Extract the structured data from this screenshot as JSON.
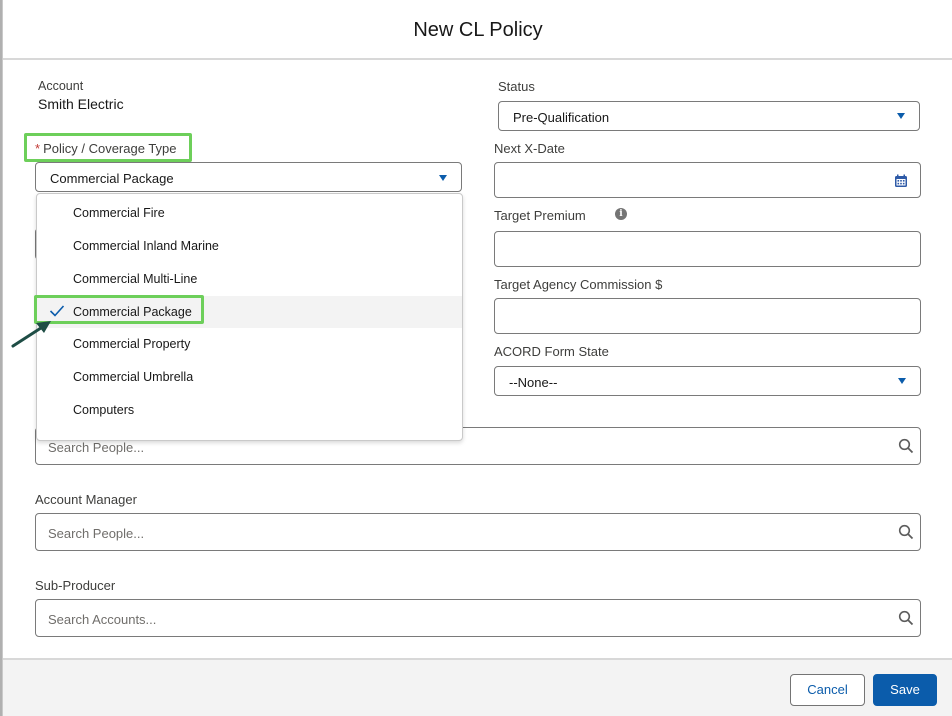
{
  "modal": {
    "title": "New CL Policy"
  },
  "account": {
    "label": "Account",
    "value": "Smith Electric"
  },
  "policy_type": {
    "label": "Policy / Coverage Type",
    "required_marker": "*",
    "value": "Commercial Package",
    "options": [
      "Commercial Fire",
      "Commercial Inland Marine",
      "Commercial Multi-Line",
      "Commercial Package",
      "Commercial Property",
      "Commercial Umbrella",
      "Computers"
    ],
    "selected_option": "Commercial Package"
  },
  "status": {
    "label": "Status",
    "value": "Pre-Qualification"
  },
  "next_x_date": {
    "label": "Next X-Date",
    "value": ""
  },
  "target_premium": {
    "label": "Target Premium",
    "info_icon": "i",
    "value": ""
  },
  "target_agency_commission": {
    "label": "Target Agency Commission $",
    "value": ""
  },
  "acord_form_state": {
    "label": "ACORD Form State",
    "value": "--None--"
  },
  "producer_search": {
    "placeholder": "Search People..."
  },
  "account_manager": {
    "label": "Account Manager",
    "placeholder": "Search People..."
  },
  "sub_producer": {
    "label": "Sub-Producer",
    "placeholder": "Search Accounts..."
  },
  "footer": {
    "cancel_label": "Cancel",
    "save_label": "Save"
  },
  "colors": {
    "brand_blue": "#0b5cab",
    "highlight_green": "#6dcf5a",
    "required_red": "#c23934",
    "arrow": "#1e4d45"
  }
}
